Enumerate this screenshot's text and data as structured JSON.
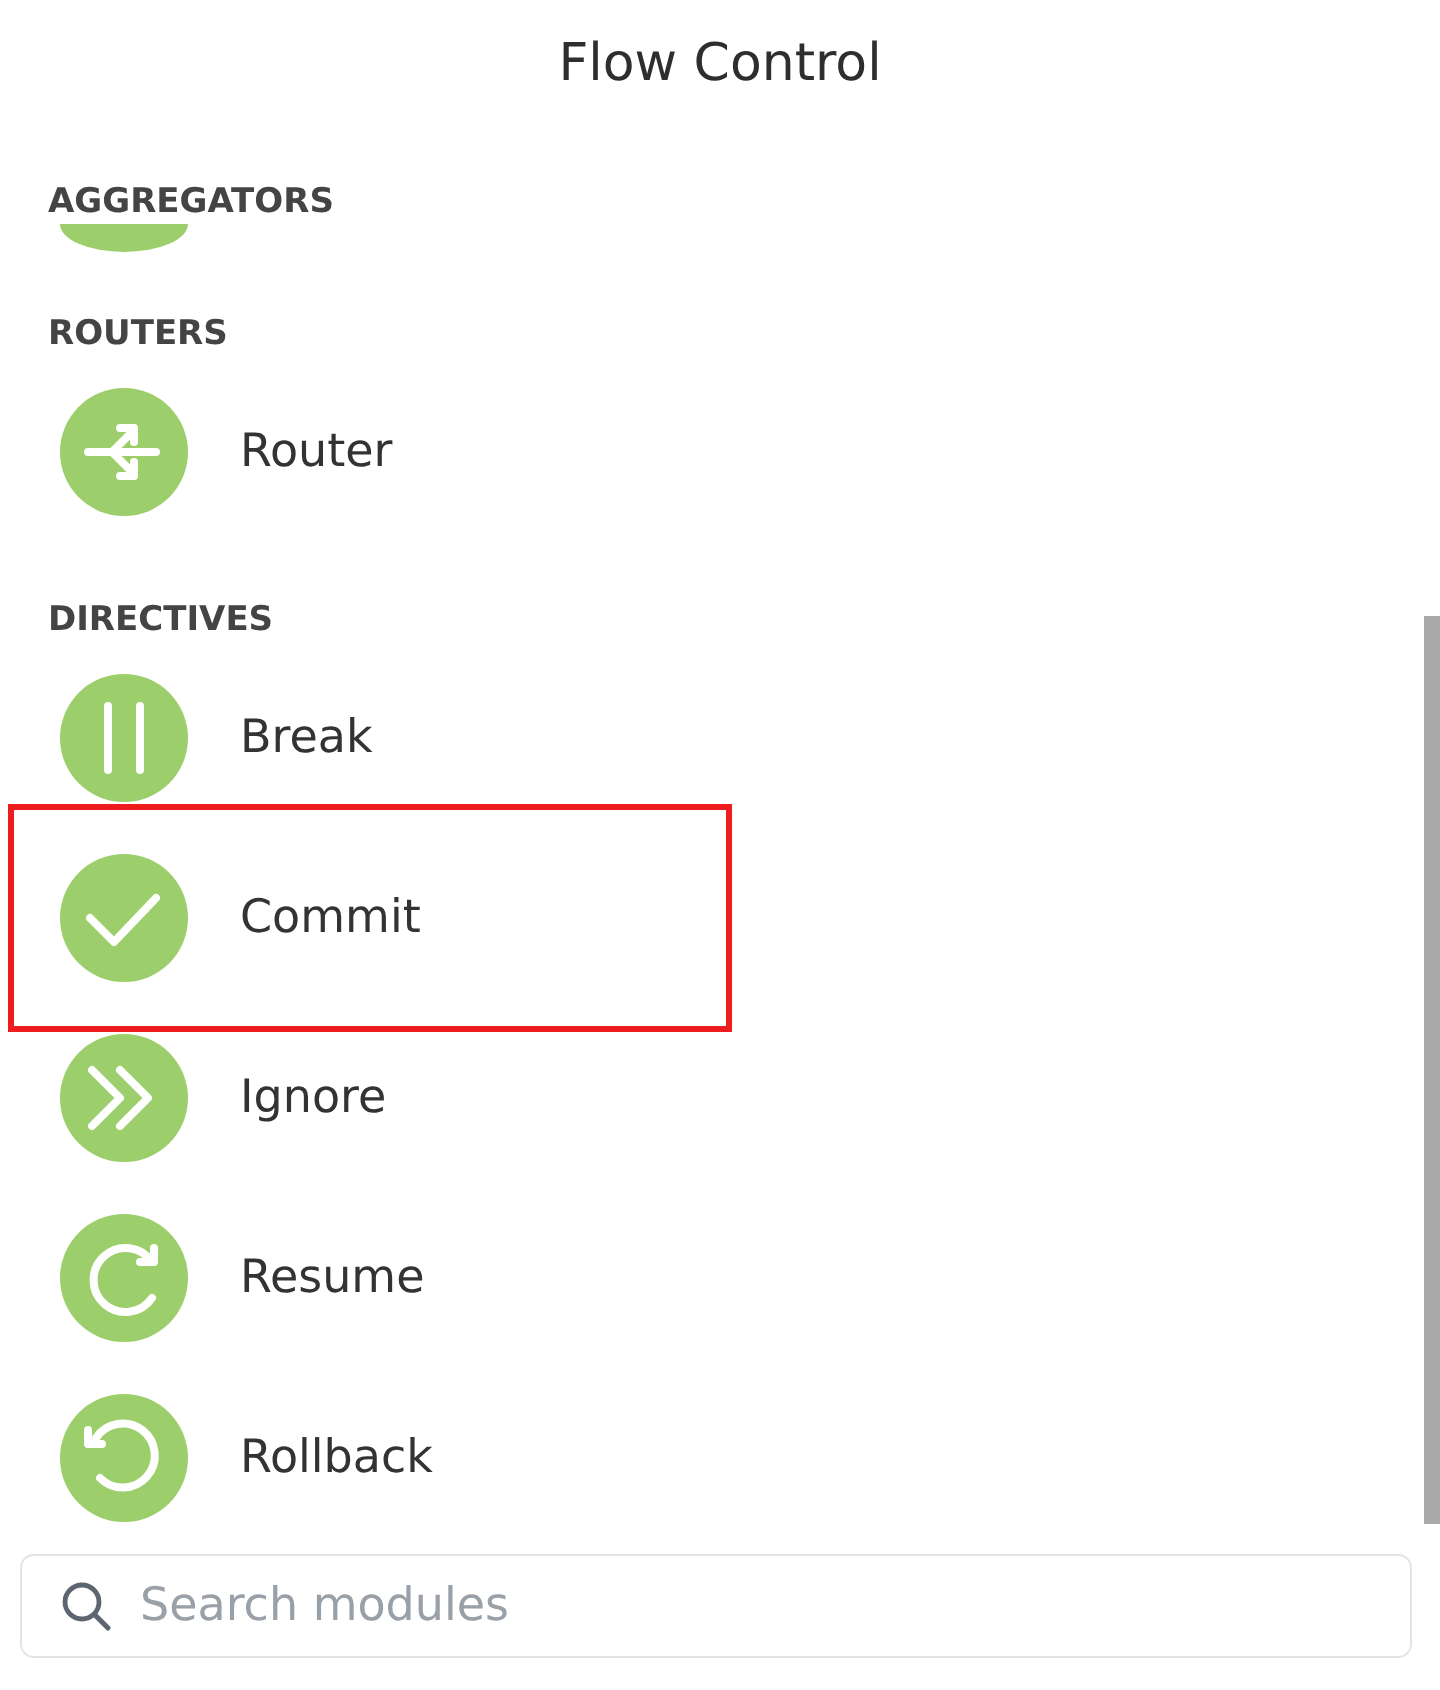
{
  "title": "Flow Control",
  "sections": [
    {
      "heading": "AGGREGATORS",
      "items": [
        {
          "kind": "partial"
        }
      ]
    },
    {
      "heading": "ROUTERS",
      "items": [
        {
          "kind": "router",
          "label": "Router",
          "highlighted": false
        }
      ]
    },
    {
      "heading": "DIRECTIVES",
      "items": [
        {
          "kind": "break",
          "label": "Break",
          "highlighted": false
        },
        {
          "kind": "commit",
          "label": "Commit",
          "highlighted": true
        },
        {
          "kind": "ignore",
          "label": "Ignore",
          "highlighted": false
        },
        {
          "kind": "resume",
          "label": "Resume",
          "highlighted": false
        },
        {
          "kind": "rollback",
          "label": "Rollback",
          "highlighted": false
        }
      ]
    }
  ],
  "search": {
    "placeholder": "Search modules"
  }
}
